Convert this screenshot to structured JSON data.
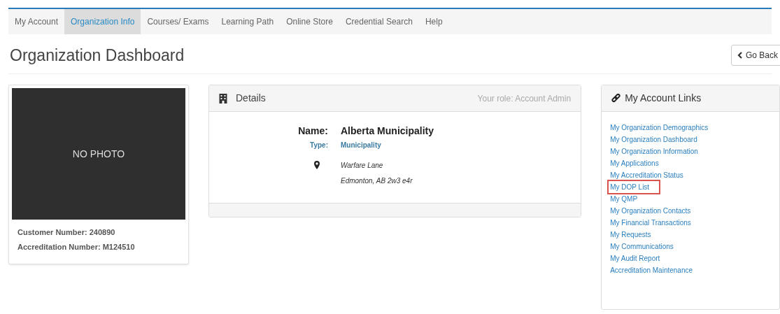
{
  "nav": [
    {
      "label": "My Account",
      "selected": false
    },
    {
      "label": "Organization Info",
      "selected": true
    },
    {
      "label": "Courses/ Exams",
      "selected": false
    },
    {
      "label": "Learning Path",
      "selected": false
    },
    {
      "label": "Online Store",
      "selected": false
    },
    {
      "label": "Credential Search",
      "selected": false
    },
    {
      "label": "Help",
      "selected": false
    }
  ],
  "page_title": "Organization Dashboard",
  "go_back": "Go Back",
  "profile": {
    "photo_placeholder": "NO PHOTO",
    "customer_number": "Customer Number: 240890",
    "accreditation_number": "Accreditation Number: M124510"
  },
  "details": {
    "title": "Details",
    "role": "Your role: Account Admin",
    "name_label": "Name:",
    "name": "Alberta Municipality",
    "type_label": "Type:",
    "type": "Municipality",
    "address_lines": [
      "Warfare Lane",
      "Edmonton, AB 2w3 e4r"
    ]
  },
  "links": {
    "title": "My Account Links",
    "items": [
      {
        "label": "My Organization Demographics",
        "highlighted": false
      },
      {
        "label": "My Organization Dashboard",
        "highlighted": false
      },
      {
        "label": "My Organization Information",
        "highlighted": false
      },
      {
        "label": "My Applications",
        "highlighted": false
      },
      {
        "label": "My Accreditation Status",
        "highlighted": false
      },
      {
        "label": "My DOP List",
        "highlighted": true
      },
      {
        "label": "My QMP",
        "highlighted": false
      },
      {
        "label": "My Organization Contacts",
        "highlighted": false
      },
      {
        "label": "My Financial Transactions",
        "highlighted": false
      },
      {
        "label": "My Requests",
        "highlighted": false
      },
      {
        "label": "My Communications",
        "highlighted": false
      },
      {
        "label": "My Audit Report",
        "highlighted": false
      },
      {
        "label": "Accreditation Maintenance",
        "highlighted": false
      }
    ]
  }
}
